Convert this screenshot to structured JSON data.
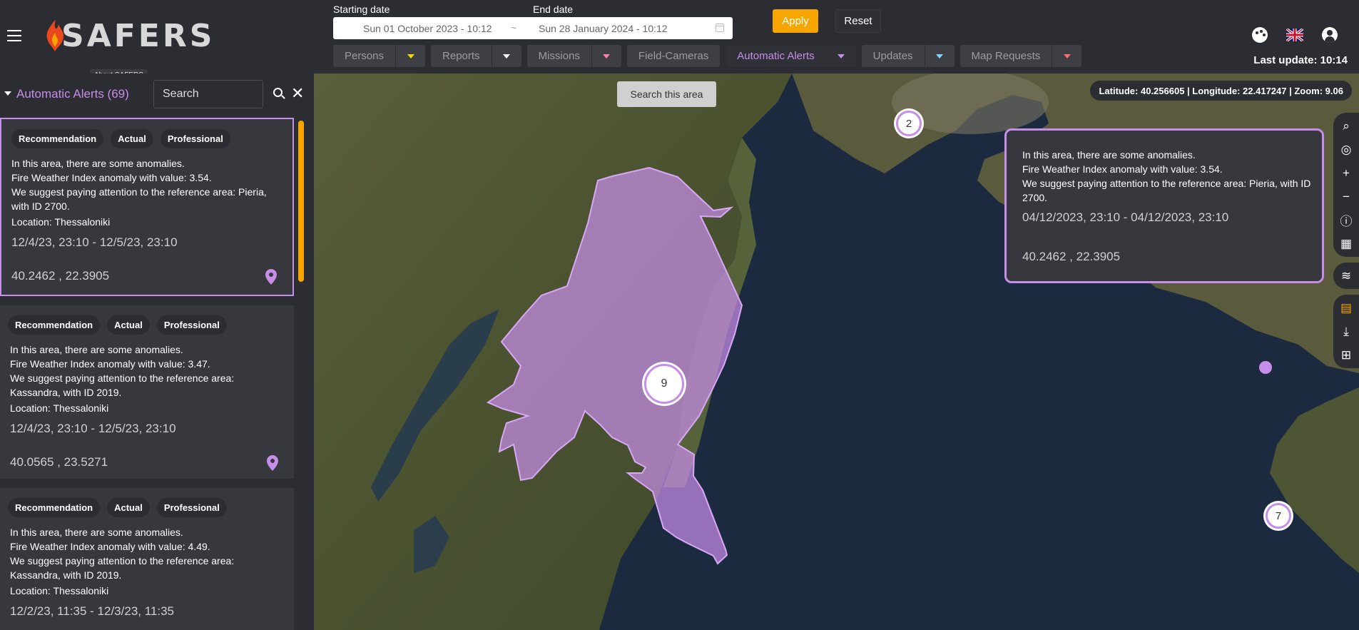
{
  "app": {
    "logo_text": "SAFERS",
    "logo_tooltip": "About SAFERS"
  },
  "date_filter": {
    "start_label": "Starting date",
    "end_label": "End date",
    "start_value": "Sun 01 October 2023 - 10:12",
    "separator": "~",
    "end_value": "Sun 28 January 2024 - 10:12",
    "apply_label": "Apply",
    "reset_label": "Reset"
  },
  "layer_tabs": [
    {
      "label": "Persons",
      "arrow_color": "#f7d600"
    },
    {
      "label": "Reports",
      "arrow_color": "#ffffff"
    },
    {
      "label": "Missions",
      "arrow_color": "#ff7fb2"
    },
    {
      "label": "Field-Cameras"
    },
    {
      "label": "Automatic Alerts",
      "arrow_color": "#c68ee8",
      "active": true
    },
    {
      "label": "Updates",
      "arrow_color": "#7fd6ff"
    },
    {
      "label": "Map Requests",
      "arrow_color": "#ff6b6b"
    }
  ],
  "header_icons": [
    "palette-icon",
    "uk-flag-icon",
    "account-icon"
  ],
  "last_update": "Last update: 10:14",
  "sidebar": {
    "title": "Automatic Alerts (69)",
    "search_placeholder": "Search",
    "cards": [
      {
        "chips": [
          "Recommendation",
          "Actual",
          "Professional"
        ],
        "description": "In this area, there are some anomalies.\nFire Weather Index anomaly with value: 3.54.\nWe suggest paying attention to the reference area: Pieria, with ID 2700.",
        "location": "Location: Thessaloniki",
        "time": "12/4/23, 23:10 - 12/5/23, 23:10",
        "coords": "40.2462 , 22.3905",
        "selected": true
      },
      {
        "chips": [
          "Recommendation",
          "Actual",
          "Professional"
        ],
        "description": "In this area, there are some anomalies.\nFire Weather Index anomaly with value: 3.47.\nWe suggest paying attention to the reference area: Kassandra, with ID 2019.",
        "location": "Location: Thessaloniki",
        "time": "12/4/23, 23:10 - 12/5/23, 23:10",
        "coords": "40.0565 , 23.5271"
      },
      {
        "chips": [
          "Recommendation",
          "Actual",
          "Professional"
        ],
        "description": "In this area, there are some anomalies.\nFire Weather Index anomaly with value: 4.49.\nWe suggest paying attention to the reference area: Kassandra, with ID 2019.",
        "location": "Location: Thessaloniki",
        "time": "12/2/23, 11:35 - 12/3/23, 11:35"
      }
    ]
  },
  "map": {
    "search_area_label": "Search this area",
    "coords_readout": "Latitude: 40.256605 | Longitude: 22.417247 | Zoom: 9.06",
    "clusters": [
      "2",
      "9",
      "7"
    ],
    "popup": {
      "description": "In this area, there are some anomalies.\nFire Weather Index anomaly with value: 3.54.\nWe suggest paying attention to the reference area: Pieria, with ID 2700.",
      "time": "04/12/2023, 23:10 - 04/12/2023, 23:10",
      "coords": "40.2462 , 22.3905"
    },
    "accent_color": "#c68ee8"
  }
}
